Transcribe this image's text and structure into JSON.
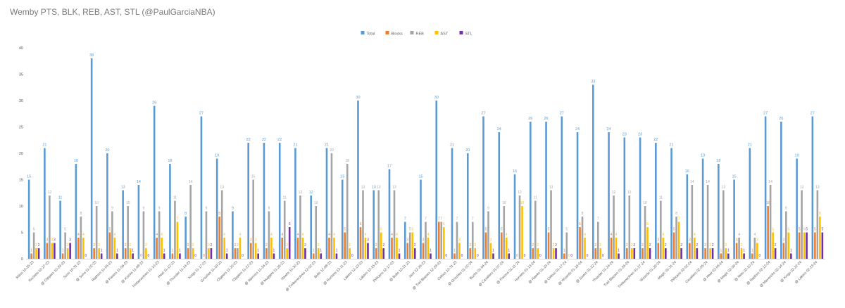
{
  "chart_data": {
    "type": "bar",
    "title": "Wemby PTS, BLK, REB, AST, STL (@PaulGarciaNBA)",
    "ylim": [
      0,
      40
    ],
    "yticks": [
      0,
      5,
      10,
      15,
      20,
      25,
      30,
      35,
      40
    ],
    "grid": false,
    "legend_position": "top-center",
    "categories": [
      "Mavs 10-25-23",
      "Rockets 10-27-23",
      "@ Clippers 10-29-23",
      "Suns 10-31-23",
      "@ Suns 11-02-23",
      "Raptors 11-05-23",
      "@ Pacers 11-06-23",
      "@ Knicks 11-08-23",
      "Timberwolves 11-10-23",
      "Heat 11-12-23",
      "@ Thunder 11-14-23",
      "Kings 11-17-23",
      "Grizzlies 11-18-23",
      "Clippers 11-20-23",
      "Clippers 11-22-23",
      "@ Warriors 11-24-23",
      "@ Nuggets 11-26-23",
      "Hawks 11-30-23",
      "@ Timberwolves 12-02-23",
      "Bulls 12-08-23",
      "@ Rockets 12-11-23",
      "Lakers 12-13-23",
      "Lakers 12-15-23",
      "Pelicans 12-17-23",
      "@ Bulls 12-21-23",
      "Jazz 12-26-23",
      "@ Trail Blazers 12-28-23",
      "Celtics 12-31-23",
      "@ Grizzlies 01-02-24",
      "Bucks 01-04-24",
      "@ Cavaliers 01-07-24",
      "@ Pistons 01-11-24",
      "Hornets 01-13-24",
      "@ Hawks 01-15-24",
      "@ Celtics 01-17-24",
      "@ Wizards 01-19-24",
      "@ Sixers 01-22-24",
      "Thunder 01-24-24",
      "Trail Blazers 01-26-24",
      "Timberwolves 01-27-24",
      "Wizards 01-29-24",
      "Magic 01-31-24",
      "Pelicans 02-02-24",
      "Cavaliers 02-05-24",
      "@ Heat 02-08-24",
      "@ Magic 02-09-24",
      "@ Nets 02-10-24",
      "@ Raptors 02-12-24",
      "@ Mavericks 02-14-24",
      "@ Kings 02-22-24",
      "@ Lakers 02-23-24"
    ],
    "series": [
      {
        "name": "Total",
        "color": "#5b9bd5",
        "values": [
          15,
          21,
          11,
          18,
          38,
          20,
          13,
          14,
          29,
          18,
          8,
          27,
          19,
          9,
          22,
          22,
          22,
          21,
          12,
          21,
          15,
          30,
          13,
          17,
          7,
          15,
          30,
          21,
          20,
          27,
          24,
          16,
          26,
          26,
          27,
          24,
          33,
          24,
          23,
          23,
          22,
          21,
          16,
          19,
          18,
          15,
          21,
          27,
          26,
          19,
          27
        ]
      },
      {
        "name": "Blocks",
        "color": "#ed7d31",
        "values": [
          1,
          3,
          1,
          4,
          2,
          5,
          2,
          0,
          4,
          1,
          2,
          0,
          8,
          2,
          3,
          2,
          4,
          4,
          1,
          4,
          5,
          6,
          2,
          4,
          3,
          3,
          7,
          1,
          2,
          5,
          5,
          0,
          2,
          5,
          1,
          6,
          2,
          4,
          2,
          2,
          3,
          5,
          3,
          2,
          1,
          3,
          1,
          10,
          3,
          5,
          5
        ]
      },
      {
        "name": "REB",
        "color": "#a5a5a5",
        "values": [
          5,
          12,
          5,
          8,
          10,
          9,
          10,
          9,
          9,
          11,
          14,
          9,
          13,
          2,
          15,
          9,
          11,
          12,
          10,
          20,
          18,
          13,
          13,
          13,
          5,
          7,
          7,
          7,
          7,
          9,
          10,
          12,
          11,
          13,
          5,
          8,
          7,
          12,
          12,
          10,
          11,
          8,
          14,
          14,
          13,
          4,
          4,
          14,
          9,
          13,
          13
        ]
      },
      {
        "name": "AST",
        "color": "#ffc000",
        "values": [
          2,
          3,
          2,
          4,
          2,
          4,
          2,
          2,
          4,
          7,
          2,
          2,
          4,
          4,
          3,
          4,
          2,
          4,
          2,
          4,
          2,
          4,
          5,
          4,
          5,
          4,
          6,
          3,
          2,
          3,
          4,
          10,
          2,
          2,
          0,
          4,
          2,
          4,
          2,
          6,
          4,
          7,
          4,
          2,
          2,
          2,
          3,
          5,
          5,
          5,
          8
        ]
      },
      {
        "name": "STL",
        "color": "#7030a0",
        "values": [
          2,
          3,
          3,
          0,
          1,
          1,
          1,
          0,
          1,
          1,
          0,
          2,
          1,
          0,
          1,
          1,
          6,
          2,
          1,
          1,
          0,
          3,
          2,
          1,
          2,
          1,
          0,
          0,
          0,
          1,
          1,
          0,
          0,
          2,
          0,
          0,
          0,
          1,
          2,
          2,
          2,
          2,
          2,
          2,
          1,
          1,
          0,
          2,
          1,
          5,
          5
        ]
      }
    ]
  }
}
